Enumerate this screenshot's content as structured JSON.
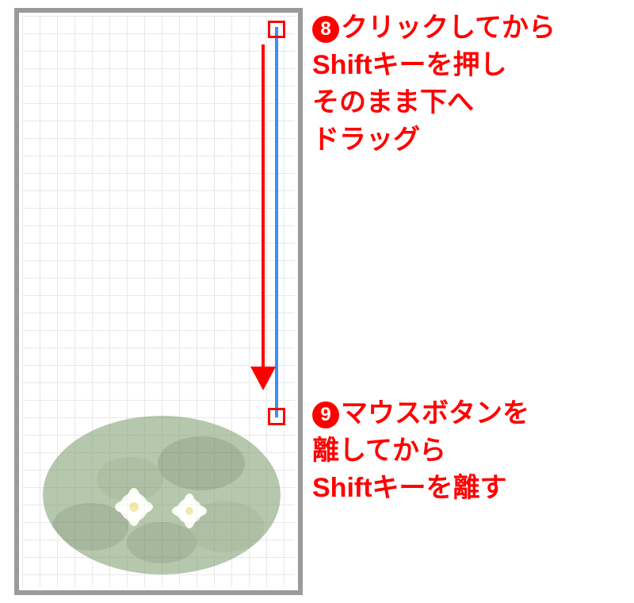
{
  "steps": {
    "s8": {
      "num": "8",
      "line1": "クリックしてから",
      "line2": "Shiftキーを押し",
      "line3": "そのまま下へ",
      "line4": "ドラッグ"
    },
    "s9": {
      "num": "9",
      "line1": "マウスボタンを",
      "line2": "離してから",
      "line3": "Shiftキーを離す"
    }
  }
}
